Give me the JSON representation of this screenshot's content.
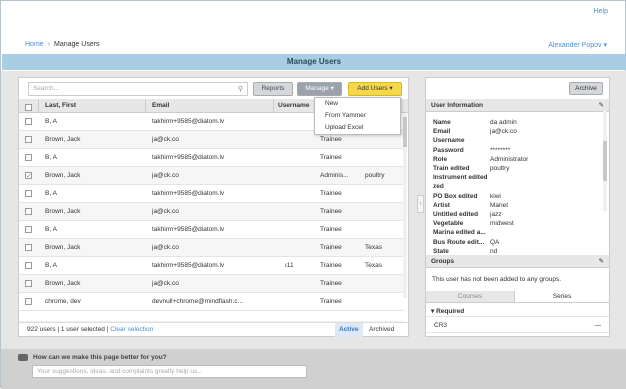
{
  "header": {
    "help": "Help",
    "breadcrumb": {
      "home": "Home",
      "separator": "›",
      "current": "Manage Users"
    },
    "user_menu": "Alexander Popov ▾"
  },
  "title": "Manage Users",
  "toolbar": {
    "search_placeholder": "Search...",
    "reports": "Reports",
    "manage": "Manage ▾",
    "add_users": "Add Users ▾"
  },
  "add_users_menu": [
    "New",
    "From Yammer",
    "Upload Excel"
  ],
  "grid": {
    "columns": [
      "Last, First",
      "Email",
      "Username",
      "Ro"
    ],
    "rows": [
      {
        "name": "B, A",
        "email": "takhirm+9585@diatom.lv",
        "username": "",
        "role": "Tra",
        "extra": "",
        "checked": false
      },
      {
        "name": "Brown, Jack",
        "email": "ja@ck.co",
        "username": "",
        "role": "Trainee",
        "extra": "",
        "checked": false
      },
      {
        "name": "B, A",
        "email": "takhirm+9585@diatom.lv",
        "username": "",
        "role": "Trainee",
        "extra": "",
        "checked": false
      },
      {
        "name": "Brown, Jack",
        "email": "ja@ck.co",
        "username": "",
        "role": "Adminis...",
        "extra": "poultry",
        "checked": true
      },
      {
        "name": "B, A",
        "email": "takhirm+9585@diatom.lv",
        "username": "",
        "role": "Trainee",
        "extra": "",
        "checked": false
      },
      {
        "name": "Brown, Jack",
        "email": "ja@ck.co",
        "username": "",
        "role": "Trainee",
        "extra": "",
        "checked": false
      },
      {
        "name": "B, A",
        "email": "takhirm+9585@diatom.lv",
        "username": "",
        "role": "Trainee",
        "extra": "",
        "checked": false
      },
      {
        "name": "Brown, Jack",
        "email": "ja@ck.co",
        "username": "",
        "role": "Trainee",
        "extra": "Texas",
        "checked": false
      },
      {
        "name": "B, A",
        "email": "takhirm+9585@diatom.lv",
        "username": "ı11",
        "role": "Trainee",
        "extra": "Texas",
        "checked": false
      },
      {
        "name": "Brown, Jack",
        "email": "ja@ck.co",
        "username": "",
        "role": "Trainee",
        "extra": "",
        "checked": false
      },
      {
        "name": "chrome, dev",
        "email": "devnull+chrome@mindflash.c...",
        "username": "",
        "role": "Trainee",
        "extra": "",
        "checked": false
      }
    ],
    "footer_count": "922 users | 1 user selected |",
    "clear_selection": "Clear selection",
    "active": "Active",
    "archived": "Archived"
  },
  "right": {
    "archive": "Archive",
    "user_info_title": "User Information",
    "fields": [
      {
        "label": "Name",
        "value": "da admin"
      },
      {
        "label": "Email",
        "value": "ja@ck.co"
      },
      {
        "label": "Username",
        "value": ""
      },
      {
        "label": "Password",
        "value": "********"
      },
      {
        "label": "Role",
        "value": "Administrator"
      },
      {
        "label": "Train edited",
        "value": "poultry"
      },
      {
        "label": "Instrument edited",
        "value": ""
      },
      {
        "label": "zed",
        "value": ""
      },
      {
        "label": "PO Box edited",
        "value": "kiwi"
      },
      {
        "label": "Artist",
        "value": "Manet"
      },
      {
        "label": "Untitled edited",
        "value": "jazz"
      },
      {
        "label": "Vegetable",
        "value": "midwest"
      },
      {
        "label": "Marina edited a...",
        "value": ""
      },
      {
        "label": "Bus Route edit...",
        "value": "QA"
      },
      {
        "label": "State",
        "value": "nd"
      }
    ],
    "groups_title": "Groups",
    "groups_text": "This user has not been added to any groups.",
    "tabs": [
      "Courses",
      "Series"
    ],
    "required": "▾ Required",
    "course": "CR3",
    "course_status": "—",
    "icon_edit": "pencil-icon"
  },
  "feedback": {
    "question": "How can we make this page better for you?",
    "placeholder": "Your suggestions, ideas, and complaints greatly help us..."
  },
  "colors": {
    "title_bar": "#a9cde3",
    "link": "#4a90d9",
    "add_button": "#f5d84a"
  }
}
